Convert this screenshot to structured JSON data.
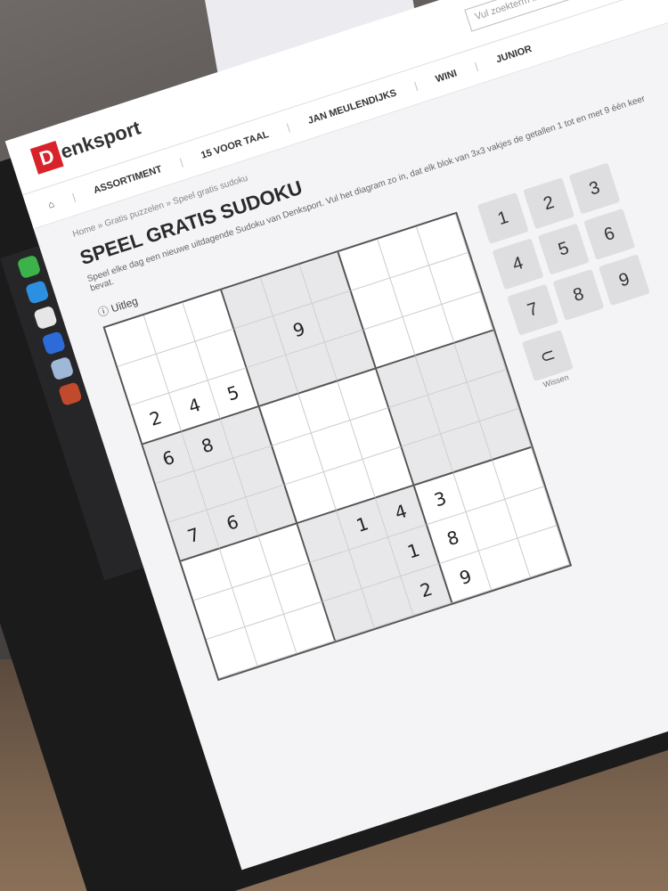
{
  "site": {
    "logo_letter": "D",
    "logo_rest": "enksport",
    "search_placeholder": "Vul zoekterm in"
  },
  "nav": {
    "items": [
      "ASSORTIMENT",
      "15 VOOR TAAL",
      "JAN MEULENDIJKS",
      "WINI",
      "JUNIOR"
    ]
  },
  "breadcrumb": "Home » Gratis puzzelen » Speel gratis sudoku",
  "page_title": "SPEEL GRATIS SUDOKU",
  "intro": "Speel elke dag een nieuwe uitdagende Sudoku van Denksport. Vul het diagram zo in, dat elk blok van 3x3 vakjes de getallen 1 tot en met 9 één keer bevat.",
  "uitleg_label": "ⓘ Uitleg",
  "board": {
    "rows": [
      [
        "",
        "",
        "",
        "",
        "",
        "",
        "",
        "",
        ""
      ],
      [
        "",
        "",
        "",
        "",
        "9",
        "",
        "",
        "",
        ""
      ],
      [
        "2",
        "4",
        "5",
        "",
        "",
        "",
        "",
        "",
        ""
      ],
      [
        "6",
        "8",
        "",
        "",
        "",
        "",
        "",
        "",
        ""
      ],
      [
        "",
        "",
        "",
        "",
        "",
        "",
        "",
        "",
        ""
      ],
      [
        "7",
        "6",
        "",
        "",
        "",
        "",
        "",
        "",
        ""
      ],
      [
        "",
        "",
        "",
        "",
        "1",
        "4",
        "3",
        "",
        ""
      ],
      [
        "",
        "",
        "",
        "",
        "",
        "1",
        "8",
        "",
        ""
      ],
      [
        "",
        "",
        "",
        "",
        "",
        "2",
        "9",
        "",
        ""
      ]
    ]
  },
  "keypad": {
    "keys": [
      "1",
      "2",
      "3",
      "4",
      "5",
      "6",
      "7",
      "8",
      "9"
    ],
    "erase_symbol": "⊂",
    "erase_label": "Wissen"
  },
  "colors": {
    "brand": "#d8232a",
    "shaded_cell": "#e8e8ea",
    "key_bg": "#dedee0"
  }
}
